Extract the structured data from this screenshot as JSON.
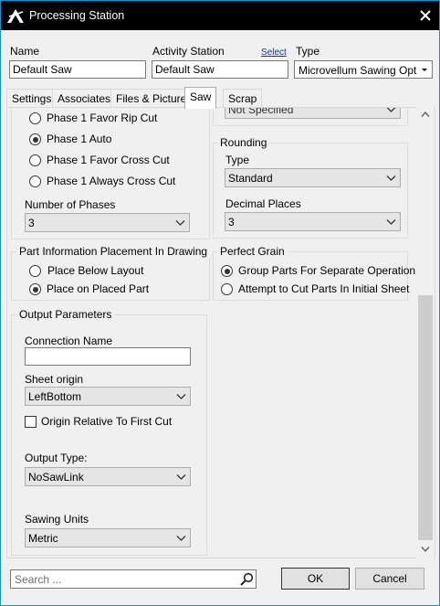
{
  "window": {
    "title": "Processing Station"
  },
  "header": {
    "name_label": "Name",
    "name_value": "Default Saw",
    "activity_label": "Activity Station",
    "select_link": "Select",
    "activity_value": "Default Saw",
    "type_label": "Type",
    "type_value": "Microvellum Sawing Optimiz"
  },
  "tabs": [
    {
      "label": "Settings"
    },
    {
      "label": "Associates"
    },
    {
      "label": "Files & Pictures"
    },
    {
      "label": "Saw",
      "active": true
    },
    {
      "label": "Scrap"
    }
  ],
  "phases": {
    "options": [
      {
        "label": "Phase 1 Favor Rip Cut",
        "selected": false
      },
      {
        "label": "Phase 1 Auto",
        "selected": true
      },
      {
        "label": "Phase 1 Favor Cross Cut",
        "selected": false
      },
      {
        "label": "Phase 1 Always Cross Cut",
        "selected": false
      }
    ],
    "number_label": "Number of Phases",
    "number_value": "3"
  },
  "top_right_combo_value": "Not Specified",
  "rounding": {
    "title": "Rounding",
    "type_label": "Type",
    "type_value": "Standard",
    "decimal_label": "Decimal Places",
    "decimal_value": "3"
  },
  "part_info": {
    "title": "Part Information Placement In Drawing",
    "options": [
      {
        "label": "Place Below Layout",
        "selected": false
      },
      {
        "label": "Place on Placed Part",
        "selected": true
      }
    ]
  },
  "perfect_grain": {
    "title": "Perfect Grain",
    "options": [
      {
        "label": "Group Parts For Separate Operation",
        "selected": true
      },
      {
        "label": "Attempt to Cut Parts In Initial Sheet",
        "selected": false
      }
    ]
  },
  "output": {
    "title": "Output Parameters",
    "connection_label": "Connection Name",
    "connection_value": "",
    "sheet_origin_label": "Sheet origin",
    "sheet_origin_value": "LeftBottom",
    "origin_relative_label": "Origin Relative To First Cut",
    "origin_relative_checked": false,
    "output_type_label": "Output Type:",
    "output_type_value": "NoSawLink",
    "units_label": "Sawing Units",
    "units_value": "Metric"
  },
  "footer": {
    "search_placeholder": "Search ...",
    "ok_label": "OK",
    "cancel_label": "Cancel"
  },
  "colors": {
    "title_bar": "#000000",
    "window_border": "#1e90c8",
    "link": "#0033cc",
    "panel_bg": "#f0f0f0"
  }
}
